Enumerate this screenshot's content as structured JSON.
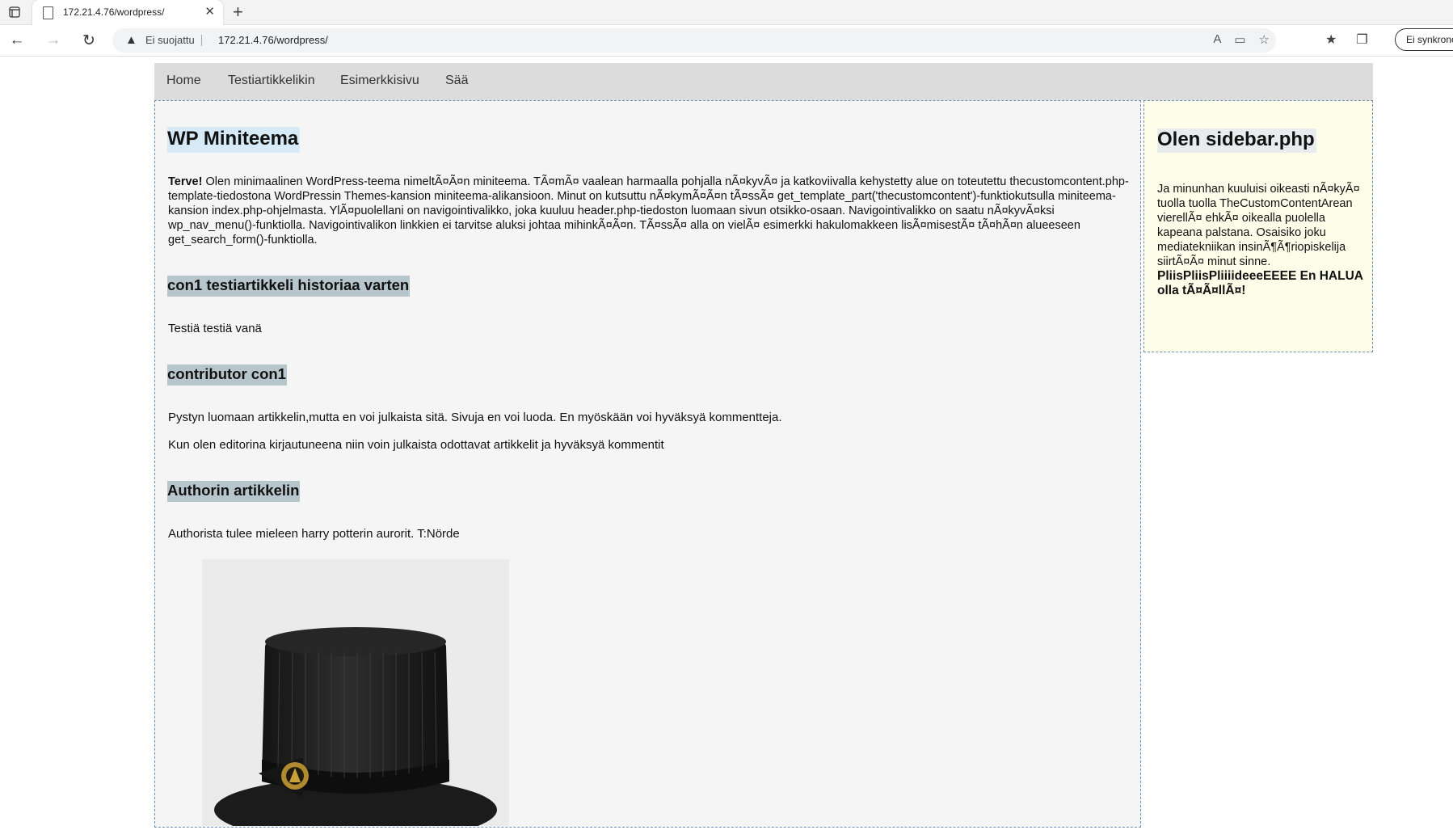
{
  "browser": {
    "tab_title": "172.21.4.76/wordpress/",
    "security_label": "Ei suojattu",
    "url": "172.21.4.76/wordpress/",
    "sync_label": "Ei synkronoi"
  },
  "menu": {
    "items": [
      "Home",
      "Testiartikkelikin",
      "Esimerkkisivu",
      "Sää"
    ]
  },
  "content": {
    "title": "WP Miniteema",
    "intro_bold": "Terve!",
    "intro_text": " Olen minimaalinen WordPress-teema nimeltÃ¤Ã¤n miniteema. TÃ¤mÃ¤ vaalean harmaalla pohjalla nÃ¤kyvÃ¤ ja katkoviivalla kehystetty alue on toteutettu thecustomcontent.php-template-tiedostona WordPressin Themes-kansion miniteema-alikansioon. Minut on kutsuttu nÃ¤kymÃ¤Ã¤n tÃ¤ssÃ¤ get_template_part('thecustomcontent')-funktiokutsulla miniteema-kansion index.php-ohjelmasta. YlÃ¤puolellani on navigointivalikko, joka kuuluu header.php-tiedoston luomaan sivun otsikko-osaan. Navigointivalikko on saatu nÃ¤kyvÃ¤ksi wp_nav_menu()-funktiolla. Navigointivalikon linkkien ei tarvitse aluksi johtaa mihinkÃ¤Ã¤n. TÃ¤ssÃ¤ alla on vielÃ¤ esimerkki hakulomakkeen lisÃ¤misestÃ¤ tÃ¤hÃ¤n alueeseen get_search_form()-funktiolla.",
    "posts": [
      {
        "title": "con1 testiartikkeli historiaa varten",
        "paragraphs": [
          "Testiä testiä vanä"
        ]
      },
      {
        "title": "contributor con1",
        "paragraphs": [
          "Pystyn luomaan artikkelin,mutta en voi julkaista sitä. Sivuja en voi luoda. En myöskään voi hyväksyä kommentteja.",
          "Kun olen editorina kirjautuneena niin voin julkaista odottavat artikkelit ja hyväksyä kommentit"
        ]
      },
      {
        "title": "Authorin artikkelin",
        "paragraphs": [
          "Authorista tulee mieleen harry potterin aurorit. T:Nörde"
        ]
      }
    ]
  },
  "sidebar": {
    "title": "Olen sidebar.php",
    "text": "Ja minunhan kuuluisi oikeasti nÃ¤kyÃ¤ tuolla tuolla TheCustomContentArean vierellÃ¤ ehkÃ¤ oikealla puolella kapeana palstana. Osaisiko joku mediatekniikan insinÃ¶Ã¶riopiskelija siirtÃ¤Ã¤ minut sinne.",
    "bold_text": "PliisPliisPliiiideeeEEEE En HALUA olla tÃ¤Ã¤llÃ¤!"
  }
}
